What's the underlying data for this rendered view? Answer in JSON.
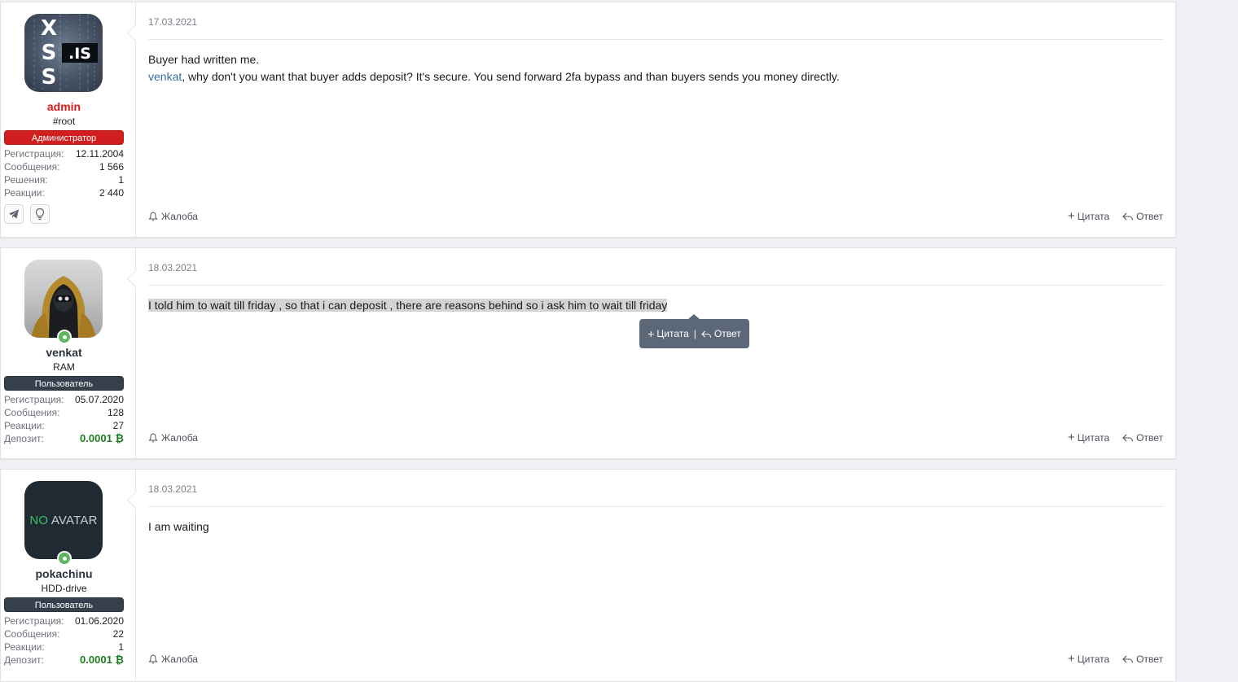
{
  "posts": [
    {
      "user": {
        "avatar_text": ".IS",
        "avatar_letters": [
          "X",
          "S",
          "S"
        ],
        "name": "admin",
        "title": "#root",
        "banner": "Администратор",
        "stats": [
          {
            "label": "Регистрация:",
            "value": "12.11.2004"
          },
          {
            "label": "Сообщения:",
            "value": "1 566"
          },
          {
            "label": "Решения:",
            "value": "1"
          },
          {
            "label": "Реакции:",
            "value": "2 440"
          }
        ]
      },
      "date": "17.03.2021",
      "body_line1": "Buyer had written me.",
      "body_link": "venkat",
      "body_line2": ", why don't you want that buyer adds deposit? It's secure. You send forward 2fa bypass and than buyers sends you money directly.",
      "report_label": "Жалоба",
      "quote_label": "Цитата",
      "reply_label": "Ответ"
    },
    {
      "user": {
        "name": "venkat",
        "title": "RAM",
        "banner": "Пользователь",
        "stats": [
          {
            "label": "Регистрация:",
            "value": "05.07.2020"
          },
          {
            "label": "Сообщения:",
            "value": "128"
          },
          {
            "label": "Реакции:",
            "value": "27"
          },
          {
            "label": "Депозит:",
            "value": "0.0001 ₿"
          }
        ]
      },
      "date": "18.03.2021",
      "body": "I told him to wait till friday , so that i can deposit , there are reasons behind so i ask him to wait till friday",
      "report_label": "Жалоба",
      "quote_label": "Цитата",
      "reply_label": "Ответ"
    },
    {
      "user": {
        "avatar_text_green": "NO",
        "avatar_text_rest": " AVATAR",
        "name": "pokachinu",
        "title": "HDD-drive",
        "banner": "Пользователь",
        "stats": [
          {
            "label": "Регистрация:",
            "value": "01.06.2020"
          },
          {
            "label": "Сообщения:",
            "value": "22"
          },
          {
            "label": "Реакции:",
            "value": "1"
          },
          {
            "label": "Депозит:",
            "value": "0.0001 ₿"
          }
        ]
      },
      "date": "18.03.2021",
      "body": "I am waiting",
      "report_label": "Жалоба",
      "quote_label": "Цитата",
      "reply_label": "Ответ"
    }
  ],
  "selection_tooltip": {
    "quote_label": "Цитата",
    "separator": "|",
    "reply_label": "Ответ"
  },
  "colors": {
    "admin_name": "#d9181b",
    "admin_banner": "#d11f1f",
    "user_banner": "#36404c",
    "deposit": "#1a7f1a",
    "link": "#3a6ea8"
  }
}
